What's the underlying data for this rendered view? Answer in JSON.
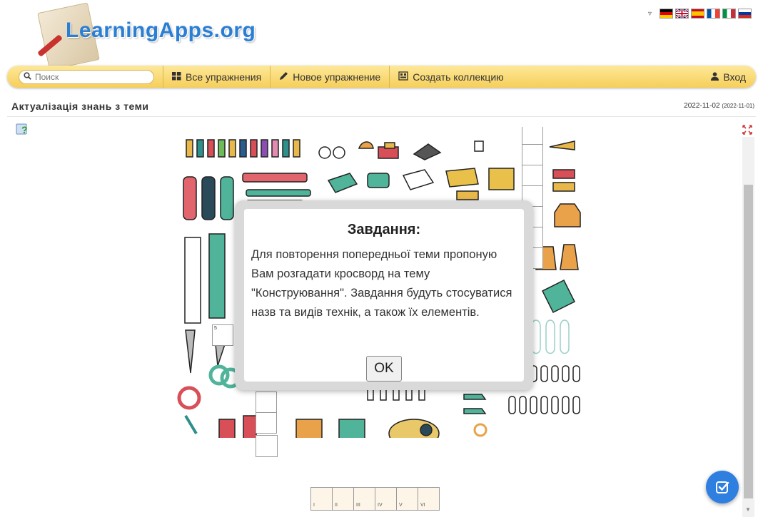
{
  "header": {
    "logo_text": "LearningApps.org",
    "languages": [
      {
        "code": "de",
        "colors": [
          "#000000",
          "#dd0000",
          "#ffce00"
        ]
      },
      {
        "code": "en",
        "colors": [
          "#012169",
          "#ffffff",
          "#c8102e"
        ]
      },
      {
        "code": "es",
        "colors": [
          "#c60b1e",
          "#ffc400",
          "#c60b1e"
        ]
      },
      {
        "code": "fr",
        "colors": [
          "#0055a4",
          "#ffffff",
          "#ef4135"
        ]
      },
      {
        "code": "it",
        "colors": [
          "#009246",
          "#ffffff",
          "#ce2b37"
        ]
      },
      {
        "code": "ru",
        "colors": [
          "#ffffff",
          "#0039a6",
          "#d52b1e"
        ]
      }
    ]
  },
  "navbar": {
    "search_placeholder": "Поиск",
    "all_exercises": "Все упражнения",
    "new_exercise": "Новое упражнение",
    "create_collection": "Создать коллекцию",
    "login": "Вход"
  },
  "page": {
    "title": "Актуалізація знань з теми",
    "date": "2022-11-02",
    "date_created": "(2022-11-01)"
  },
  "crossword": {
    "visible_number": "5",
    "bottom_labels": [
      "I",
      "II",
      "III",
      "IV",
      "V",
      "VI"
    ]
  },
  "modal": {
    "title": "Завдання:",
    "text": "Для повторення попередньої теми пропоную Вам розгадати кросворд на тему \"Конструювання\". Завдання будуть стосуватися назв та видів технік, а також їх елементів.",
    "ok_label": "OK"
  },
  "colors": {
    "navbar": "#f6cf5a",
    "logo_blue": "#2a7fd4",
    "check_button": "#2f7fe0"
  }
}
